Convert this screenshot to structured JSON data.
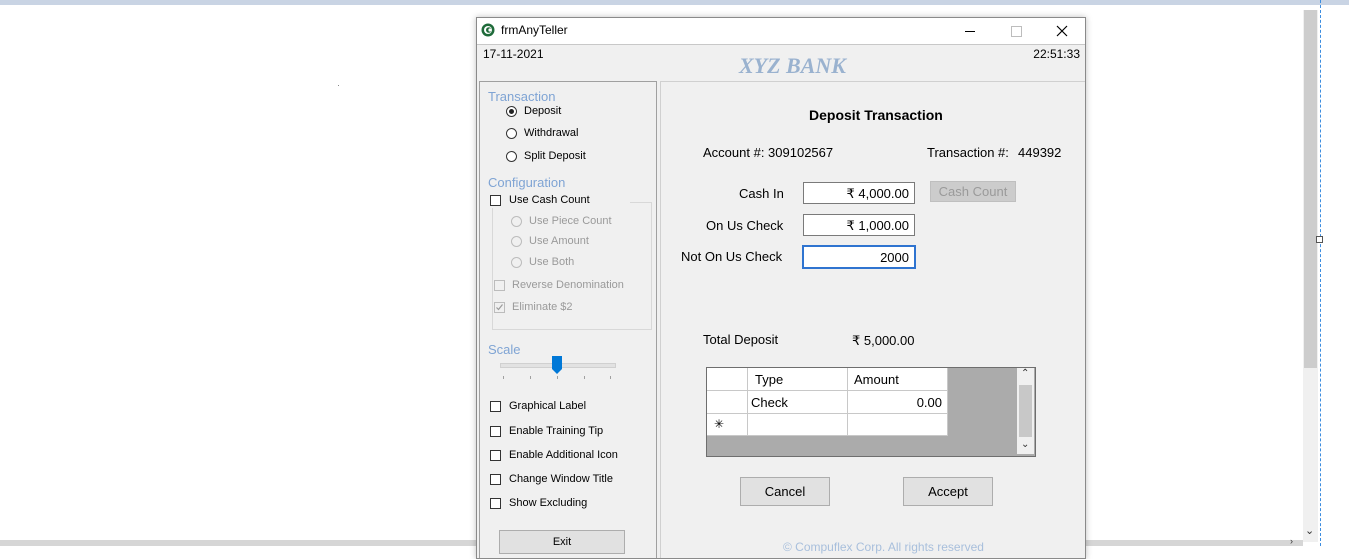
{
  "window": {
    "title": "frmAnyTeller",
    "controls": {
      "minimize": "—",
      "maximize": "□",
      "close": "✕"
    }
  },
  "header": {
    "date": "17-11-2021",
    "time": "22:51:33",
    "bank_name": "XYZ BANK"
  },
  "left_panel": {
    "transaction_group": {
      "title": "Transaction",
      "options": [
        {
          "label": "Deposit",
          "checked": true
        },
        {
          "label": "Withdrawal",
          "checked": false
        },
        {
          "label": "Split Deposit",
          "checked": false
        }
      ]
    },
    "configuration_group": {
      "title": "Configuration",
      "use_cash_count": "Use Cash Count",
      "sub_options": [
        "Use Piece Count",
        "Use Amount",
        "Use Both"
      ],
      "reverse_denomination": "Reverse Denomination",
      "eliminate": "Eliminate $2"
    },
    "scale": {
      "title": "Scale",
      "value_fraction": 0.5
    },
    "options": [
      "Graphical Label",
      "Enable Training Tip",
      "Enable Additional Icon",
      "Change Window Title",
      "Show Excluding"
    ],
    "exit_label": "Exit"
  },
  "right_panel": {
    "heading": "Deposit Transaction",
    "account": "Account #: 309102567",
    "transaction_label": "Transaction #:",
    "transaction_number": "449392",
    "cash_in_label": "Cash In",
    "cash_in_value": "₹ 4,000.00",
    "cash_count_label": "Cash Count",
    "on_us_label": "On Us Check",
    "on_us_value": "₹ 1,000.00",
    "not_on_us_label": "Not On Us Check",
    "not_on_us_value": "2000",
    "total_label": "Total Deposit",
    "total_value": "₹ 5,000.00",
    "grid": {
      "columns": [
        "Type",
        "Amount"
      ],
      "rows": [
        {
          "type": "Check",
          "amount": "0.00"
        }
      ],
      "new_row_marker": "✳"
    },
    "cancel_label": "Cancel",
    "accept_label": "Accept",
    "footer": "© Compuflex Corp. All rights reserved"
  },
  "colors": {
    "accent_blue": "#0078d7",
    "group_title": "#7fa4d4",
    "bank_title": "#9ab2cf",
    "window_bg": "#f0f0f0"
  }
}
